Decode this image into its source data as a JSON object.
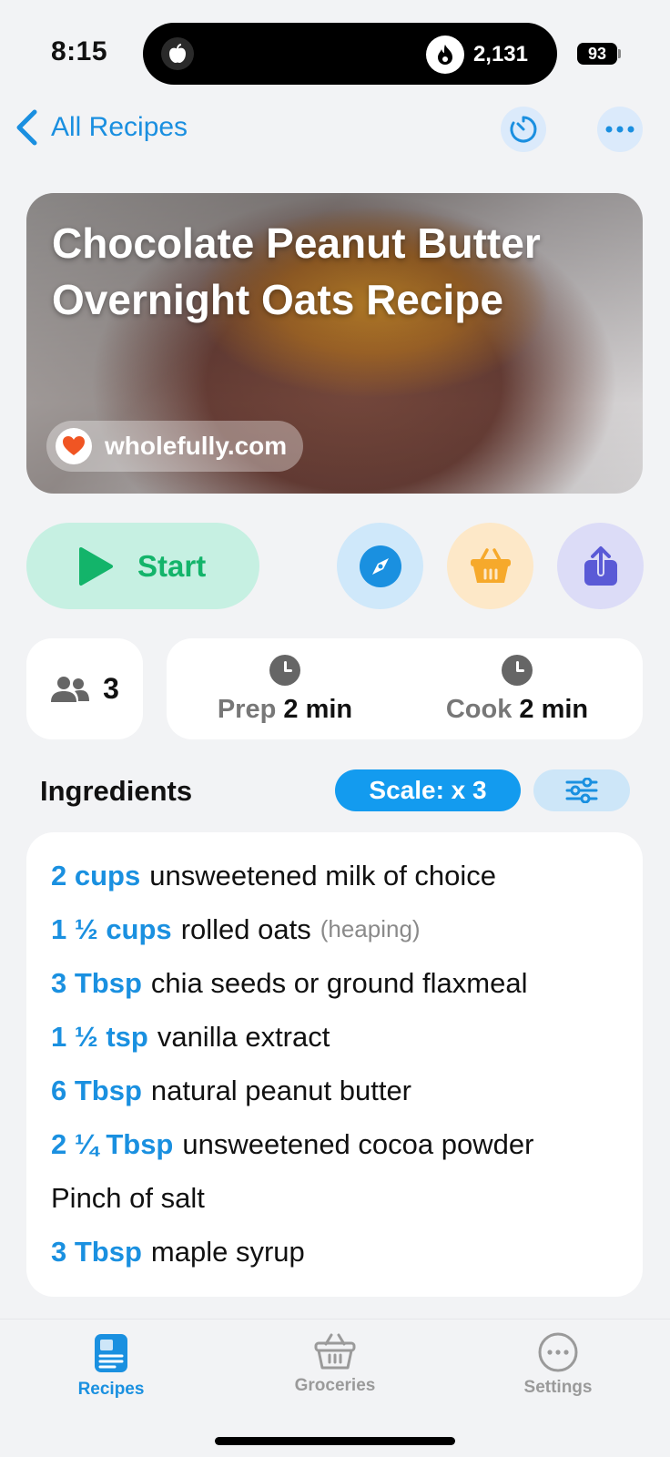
{
  "status_bar": {
    "time": "8:15",
    "activity_count": "2,131",
    "battery": "93"
  },
  "nav": {
    "back_label": "All Recipes"
  },
  "recipe": {
    "title": "Chocolate Peanut Butter Overnight Oats Recipe",
    "source": "wholefully.com"
  },
  "actions": {
    "start_label": "Start"
  },
  "info": {
    "servings": "3",
    "prep_label": "Prep",
    "prep_value": "2 min",
    "cook_label": "Cook",
    "cook_value": "2 min"
  },
  "ingredients": {
    "title": "Ingredients",
    "scale_label": "Scale: x 3",
    "items": [
      {
        "qty": "2 cups",
        "name": "unsweetened milk of choice",
        "note": ""
      },
      {
        "qty": "1 ½ cups",
        "name": "rolled oats",
        "note": "(heaping)"
      },
      {
        "qty": "3 Tbsp",
        "name": "chia seeds or ground flaxmeal",
        "note": ""
      },
      {
        "qty": "1 ½ tsp",
        "name": "vanilla extract",
        "note": ""
      },
      {
        "qty": "6 Tbsp",
        "name": "natural peanut butter",
        "note": ""
      },
      {
        "qty": "2 ¼ Tbsp",
        "name": "unsweetened cocoa powder",
        "note": ""
      },
      {
        "qty": "",
        "name": "Pinch of salt",
        "note": ""
      },
      {
        "qty": "3 Tbsp",
        "name": "maple syrup",
        "note": ""
      }
    ]
  },
  "tabs": {
    "recipes": "Recipes",
    "groceries": "Groceries",
    "settings": "Settings"
  },
  "colors": {
    "accent": "#1a90e0",
    "start_bg": "#c6f0e2",
    "start_fg": "#13b46a",
    "compass_bg": "#cfe8fa",
    "basket_bg": "#fde8c8",
    "share_bg": "#dcdcf7"
  },
  "icons": [
    "apple-icon",
    "flame-icon",
    "chevron-left-icon",
    "timer-icon",
    "more-icon",
    "heart-icon",
    "play-icon",
    "compass-icon",
    "basket-icon",
    "share-icon",
    "people-icon",
    "clock-icon",
    "sliders-icon"
  ]
}
